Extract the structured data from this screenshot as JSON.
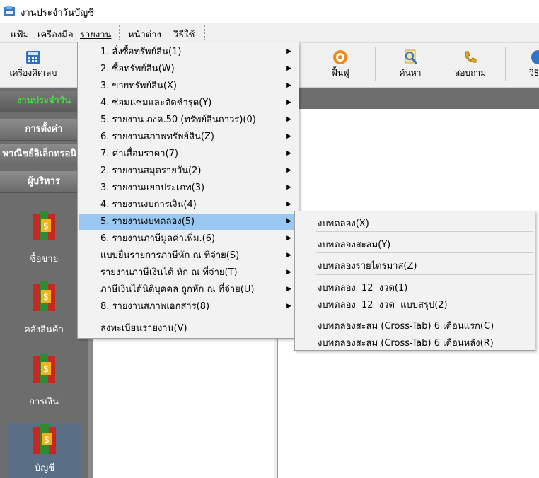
{
  "window": {
    "title": "งานประจำวันบัญชี"
  },
  "menubar": {
    "items": [
      "แฟ้ม",
      "เครื่องมือ",
      "รายงาน",
      "หน้าต่าง",
      "วิธีใช้"
    ]
  },
  "toolbar": {
    "calculator": "เครื่องคิดเลข",
    "restore": "ฟื้นฟู",
    "search": "ค้นหา",
    "inquiry": "สอบถาม",
    "help": "วิธี"
  },
  "sidebar": {
    "buttons": [
      "งานประจำวัน",
      "การตั้งค่า",
      "พาณิชย์อิเล็กทรอนิกส์",
      "ผู้บริหาร"
    ],
    "modules": [
      "ซื้อขาย",
      "คลังสินค้า",
      "การเงิน",
      "บัญชี"
    ]
  },
  "report_menu": {
    "items": [
      "1. สั่งซื้อทรัพย์สิน(1)",
      "2. ซื้อทรัพย์สิน(W)",
      "3. ขายทรัพย์สิน(X)",
      "4. ซ่อมแซมและตัดชำรุด(Y)",
      "5. รายงาน ภงด.50 (ทรัพย์สินถาวร)(0)",
      "6. รายงานสภาพทรัพย์สิน(Z)",
      "7. ค่าเสื่อมราคา(7)",
      "2. รายงานสมุดรายวัน(2)",
      "3. รายงานแยกประเภท(3)",
      "4. รายงานงบการเงิน(4)",
      "5. รายงานงบทดลอง(5)",
      "6. รายงานภาษีมูลค่าเพิ่ม.(6)",
      "แบบยื่นรายการภาษีหัก ณ ที่จ่าย(S)",
      "รายงานภาษีเงินได้ หัก ณ ที่จ่าย(T)",
      "ภาษีเงินได้นิติบุคคล ถูกหัก ณ ที่จ่าย(U)",
      "8. รายงานสภาพเอกสาร(8)",
      "ลงทะเบียนรายงาน(V)"
    ],
    "highlighted": "5. รายงานงบทดลอง(5)"
  },
  "trial_balance_submenu": {
    "items": [
      "งบทดลอง(X)",
      "งบทดลองสะสม(Y)",
      "งบทดลองรายไตรมาส(Z)",
      "งบทดลอง  12  งวด(1)",
      "งบทดลอง  12  งวด  แบบสรุป(2)",
      "งบทดลองสะสม (Cross-Tab) 6 เดือนแรก(C)",
      "งบทดลองสะสม (Cross-Tab) 6 เดือนหลัง(R)"
    ]
  },
  "colors": {
    "menu_highlight": "#99c9f1",
    "sidebar_bg": "#6d6d6d",
    "active_sidebar_text": "#3fe03f",
    "selected_module_bg": "#5a6f86"
  }
}
